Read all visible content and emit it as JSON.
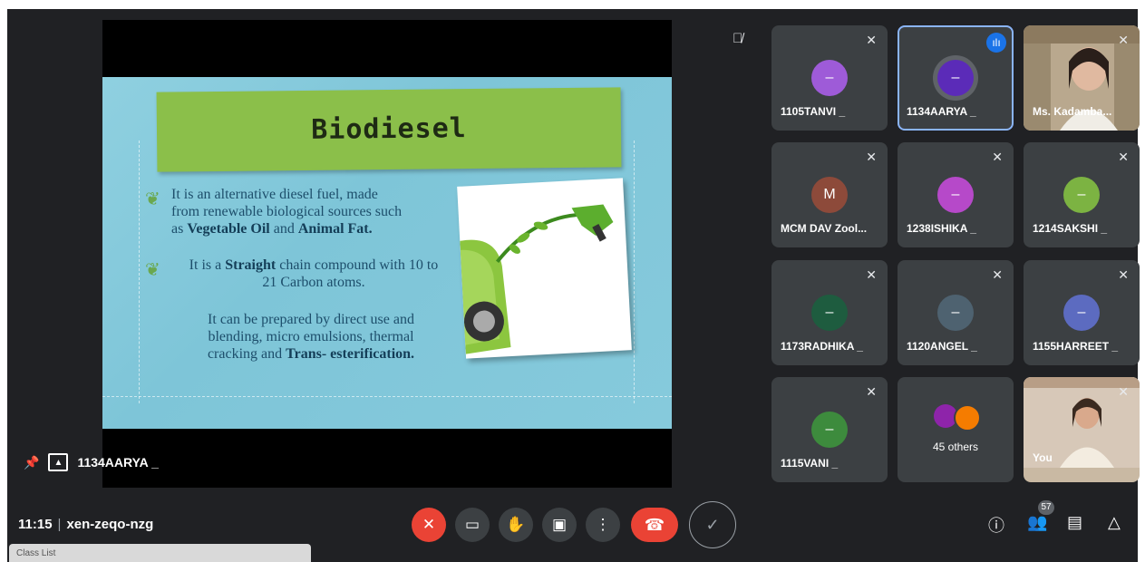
{
  "presentation": {
    "slide_title": "Biodiesel",
    "bullet1_line1": "It is an alternative diesel fuel, made",
    "bullet1_line2": "from renewable biological sources such",
    "bullet1_line3_pre": "as ",
    "bullet1_bold1": "Vegetable Oil",
    "bullet1_mid": " and ",
    "bullet1_bold2": "Animal Fat.",
    "bullet2_pre": "It is a ",
    "bullet2_bold": "Straight",
    "bullet2_post": " chain compound with 10 to",
    "bullet2_line2": "21 Carbon atoms.",
    "para_line1": "It can be prepared by direct use and",
    "para_line2": "blending, micro emulsions, thermal",
    "para_line3_pre": "cracking and ",
    "para_bold": "Trans- esterification.",
    "presenter_name": "1134AARYA _"
  },
  "participants": [
    {
      "name": "1105TANVI _",
      "initial": "–",
      "color": "#9e5bd8"
    },
    {
      "name": "1134AARYA _",
      "initial": "–",
      "color": "#5b2bb8"
    },
    {
      "name": "Ms. Kadamba..."
    },
    {
      "name": "MCM DAV Zool...",
      "initial": "M",
      "color": "#8d4a3a"
    },
    {
      "name": "1238ISHIKA _",
      "initial": "–",
      "color": "#b649c9"
    },
    {
      "name": "1214SAKSHI _",
      "initial": "–",
      "color": "#7cb342"
    },
    {
      "name": "1173RADHIKA _",
      "initial": "–",
      "color": "#1e5c3f"
    },
    {
      "name": "1120ANGEL _",
      "initial": "–",
      "color": "#4e6270"
    },
    {
      "name": "1155HARREET _",
      "initial": "–",
      "color": "#5c6bc0"
    },
    {
      "name": "1115VANI _",
      "initial": "–",
      "color": "#3d8b3d"
    },
    {
      "name": "45 others"
    },
    {
      "name": "You"
    }
  ],
  "meeting": {
    "time": "11:15",
    "separator": "|",
    "code": "xen-zeqo-nzg",
    "participant_count": "57"
  },
  "taskbar": {
    "label": "Class List"
  }
}
